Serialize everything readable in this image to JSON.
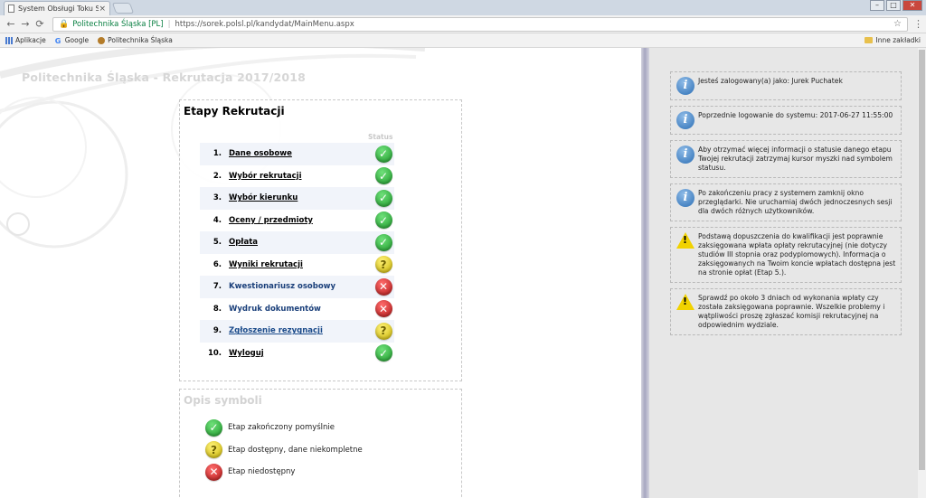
{
  "browser": {
    "tab_title": "System Obsługi Toku Stu",
    "tab_close": "×",
    "site_name": "Politechnika Śląska [PL]",
    "url": "https://sorek.polsl.pl/kandydat/MainMenu.aspx",
    "bookmarks": [
      {
        "label": "Aplikacje"
      },
      {
        "label": "Google"
      },
      {
        "label": "Politechnika Śląska"
      }
    ],
    "other_bookmarks": "Inne zakładki"
  },
  "page": {
    "title": "Politechnika Śląska - Rekrutacja 2017/2018"
  },
  "steps": {
    "heading": "Etapy Rekrutacji",
    "status_header": "Status",
    "items": [
      {
        "num": "1.",
        "label": "Dane osobowe",
        "status": "ok"
      },
      {
        "num": "2.",
        "label": "Wybór rekrutacji",
        "status": "ok"
      },
      {
        "num": "3.",
        "label": "Wybór kierunku",
        "status": "ok"
      },
      {
        "num": "4.",
        "label": "Oceny / przedmioty",
        "status": "ok"
      },
      {
        "num": "5.",
        "label": "Opłata",
        "status": "ok"
      },
      {
        "num": "6.",
        "label": "Wyniki rekrutacji",
        "status": "warn"
      },
      {
        "num": "7.",
        "label": "Kwestionariusz osobowy",
        "status": "no"
      },
      {
        "num": "8.",
        "label": "Wydruk dokumentów",
        "status": "no"
      },
      {
        "num": "9.",
        "label": "Zgłoszenie rezygnacji",
        "status": "warn"
      },
      {
        "num": "10.",
        "label": "Wyloguj",
        "status": "ok"
      }
    ]
  },
  "legend": {
    "heading": "Opis symboli",
    "items": [
      {
        "label": "Etap zakończony pomyślnie",
        "status": "ok"
      },
      {
        "label": "Etap dostępny, dane niekompletne",
        "status": "warn"
      },
      {
        "label": "Etap niedostępny",
        "status": "no"
      }
    ]
  },
  "messages": [
    {
      "type": "info",
      "text": "Jesteś zalogowany(a) jako: Jurek Puchatek"
    },
    {
      "type": "info",
      "text": "Poprzednie logowanie do systemu: 2017-06-27 11:55:00"
    },
    {
      "type": "info",
      "text": "Aby otrzymać więcej informacji o statusie danego etapu Twojej rekrutacji zatrzymaj kursor myszki nad symbolem statusu."
    },
    {
      "type": "info",
      "text": "Po zakończeniu pracy z systemem zamknij okno przeglądarki. Nie uruchamiaj dwóch jednoczesnych sesji dla dwóch różnych użytkowników."
    },
    {
      "type": "warning",
      "text": "Podstawą dopuszczenia do kwalifikacji jest poprawnie zaksięgowana wpłata opłaty rekrutacyjnej (nie dotyczy studiów III stopnia oraz podyplomowych). Informacja o zaksięgowanych na Twoim koncie wpłatach dostępna jest na stronie opłat (Etap 5.)."
    },
    {
      "type": "warning",
      "text": "Sprawdź po około 3 dniach od wykonania wpłaty czy została zaksięgowana poprawnie. Wszelkie problemy i wątpliwości proszę zgłaszać komisji rekrutacyjnej na odpowiednim wydziale."
    }
  ]
}
